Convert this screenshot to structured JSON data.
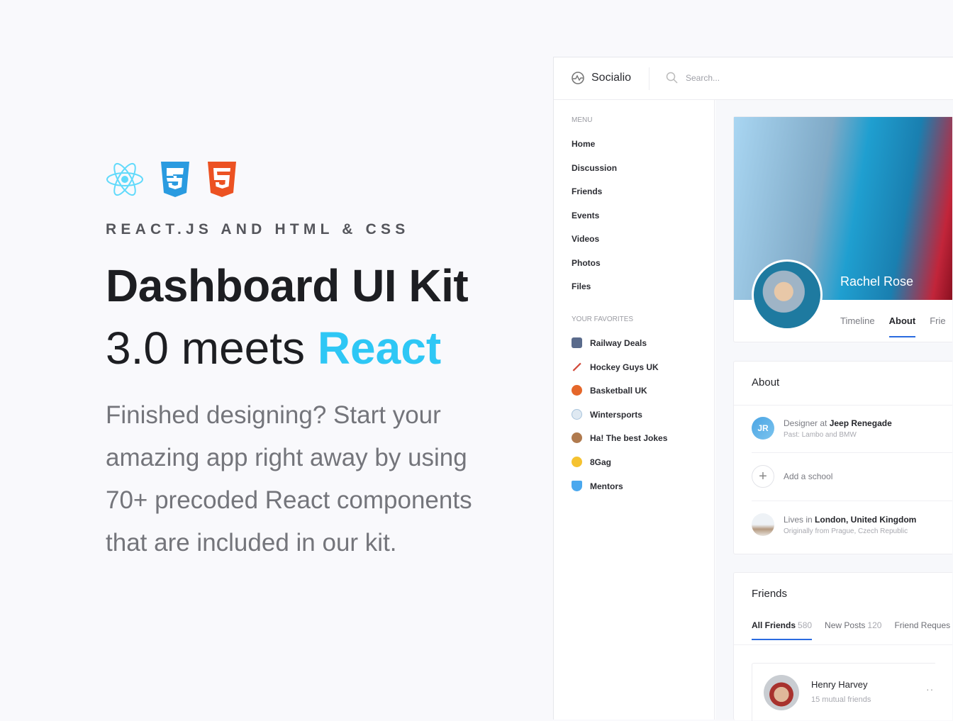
{
  "hero": {
    "tagline": "REACT.JS AND HTML & CSS",
    "title_line1": "Dashboard UI Kit",
    "title_line2_prefix": "3.0 meets ",
    "title_line2_accent": "React",
    "paragraph": "Finished designing? Start your amazing app right away by using 70+ precoded React components that are included in our kit.",
    "accent_color": "#2ec7f5",
    "logos": [
      "react-logo",
      "css3-logo",
      "html5-logo"
    ]
  },
  "app": {
    "brand": "Socialio",
    "search_placeholder": "Search...",
    "sidebar": {
      "menu_heading": "MENU",
      "menu": [
        "Home",
        "Discussion",
        "Friends",
        "Events",
        "Videos",
        "Photos",
        "Files"
      ],
      "favorites_heading": "YOUR FAVORITES",
      "favorites": [
        {
          "label": "Railway Deals",
          "icon": "train-icon",
          "color": "#5a6b8c"
        },
        {
          "label": "Hockey Guys UK",
          "icon": "hockey-icon",
          "color": "#d24b3c"
        },
        {
          "label": "Basketball UK",
          "icon": "basketball-icon",
          "color": "#e5672a"
        },
        {
          "label": "Wintersports",
          "icon": "snowman-icon",
          "color": "#a8c4dc"
        },
        {
          "label": "Ha! The best Jokes",
          "icon": "monkey-icon",
          "color": "#b07a4e"
        },
        {
          "label": "8Gag",
          "icon": "laughing-emoji-icon",
          "color": "#f5c230"
        },
        {
          "label": "Mentors",
          "icon": "gem-icon",
          "color": "#4aa8ee"
        }
      ]
    },
    "profile": {
      "name": "Rachel Rose",
      "tabs": [
        "Timeline",
        "About",
        "Frie"
      ],
      "active_tab": "About"
    },
    "about": {
      "title": "About",
      "work_prefix": "Designer at ",
      "work_company": "Jeep Renegade",
      "work_initials": "JR",
      "work_past": "Past: Lambo and BMW",
      "add_school": "Add a school",
      "lives_prefix": "Lives in ",
      "lives_place": "London, United Kingdom",
      "origin": "Originally from Prague, Czech Republic"
    },
    "friends": {
      "title": "Friends",
      "tabs": [
        {
          "label": "All Friends",
          "count": "580"
        },
        {
          "label": "New Posts",
          "count": "120"
        },
        {
          "label": "Friend Reques",
          "count": ""
        }
      ],
      "friend": {
        "name": "Henry Harvey",
        "mutual": "15 mutual friends"
      }
    }
  }
}
